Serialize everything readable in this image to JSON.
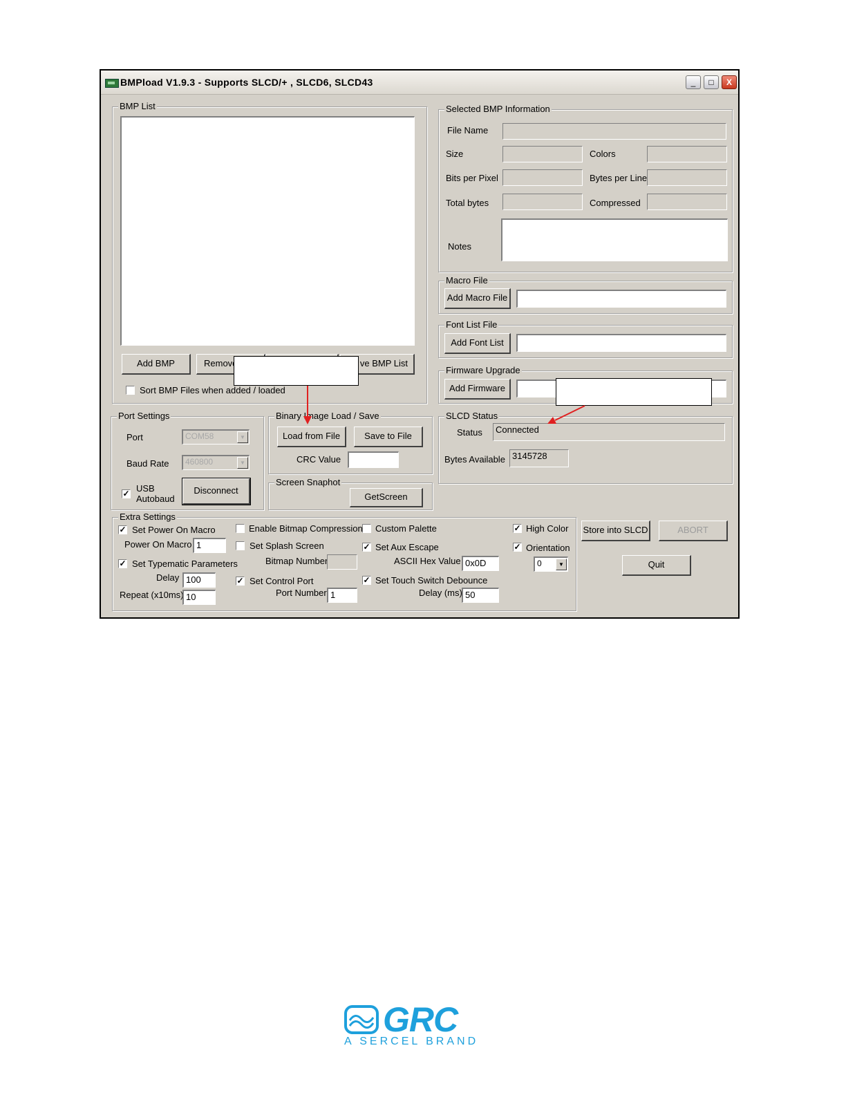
{
  "window": {
    "title": "BMPload V1.9.3 - Supports SLCD/+ , SLCD6, SLCD43",
    "controls": [
      "_",
      "□",
      "X"
    ]
  },
  "bmp_list": {
    "group_label": "BMP List",
    "buttons": {
      "add": "Add BMP",
      "remove": "Remove",
      "save": "ve BMP List"
    },
    "sort_checkbox": {
      "label": "Sort BMP Files when added / loaded",
      "checked": false
    }
  },
  "selected_bmp_info": {
    "group_label": "Selected BMP Information",
    "file_name_label": "File Name",
    "size_label": "Size",
    "colors_label": "Colors",
    "bits_per_pixel_label": "Bits per Pixel",
    "bytes_per_line_label": "Bytes per Line",
    "total_bytes_label": "Total bytes",
    "compressed_label": "Compressed",
    "notes_label": "Notes"
  },
  "macro_file": {
    "group_label": "Macro File",
    "button": "Add Macro File",
    "value": ""
  },
  "font_list_file": {
    "group_label": "Font List File",
    "button": "Add Font List",
    "value": ""
  },
  "firmware_upgrade": {
    "group_label": "Firmware Upgrade",
    "button": "Add Firmware",
    "value": ""
  },
  "port_settings": {
    "group_label": "Port Settings",
    "port_label": "Port",
    "port_value": "COM58",
    "baud_label": "Baud Rate",
    "baud_value": "460800",
    "usb_label_1": "USB",
    "usb_label_2": "Autobaud",
    "usb_checked": true,
    "disconnect_button": "Disconnect"
  },
  "binary_image": {
    "group_label": "Binary Image Load / Save",
    "load_button": "Load from File",
    "save_button": "Save to File",
    "crc_label": "CRC Value",
    "crc_value": ""
  },
  "screen_snapshot": {
    "group_label": "Screen Snaphot",
    "button": "GetScreen"
  },
  "slcd_status": {
    "group_label": "SLCD Status",
    "status_label": "Status",
    "status_value": "Connected",
    "bytes_label": "Bytes Available",
    "bytes_value": "3145728"
  },
  "extra_settings": {
    "group_label": "Extra Settings",
    "set_power_on_macro": {
      "label": "Set Power On Macro",
      "checked": true
    },
    "power_on_macro_label": "Power On Macro",
    "power_on_macro_value": "1",
    "set_typematic": {
      "label": "Set Typematic Parameters",
      "checked": true
    },
    "delay_label": "Delay",
    "delay_value": "100",
    "repeat_label": "Repeat (x10ms)",
    "repeat_value": "10",
    "enable_bitmap_compression": {
      "label": "Enable Bitmap Compression",
      "checked": false
    },
    "set_splash_screen": {
      "label": "Set Splash Screen",
      "checked": false
    },
    "bitmap_number_label": "Bitmap Number",
    "bitmap_number_value": "",
    "set_control_port": {
      "label": "Set Control Port",
      "checked": true
    },
    "port_number_label": "Port Number",
    "port_number_value": "1",
    "custom_palette": {
      "label": "Custom Palette",
      "checked": false
    },
    "set_aux_escape": {
      "label": "Set Aux Escape",
      "checked": true
    },
    "ascii_hex_label": "ASCII Hex Value",
    "ascii_hex_value": "0x0D",
    "set_touch_debounce": {
      "label": "Set Touch Switch Debounce",
      "checked": true
    },
    "debounce_delay_label": "Delay (ms)",
    "debounce_delay_value": "50",
    "high_color": {
      "label": "High Color",
      "checked": true
    },
    "orientation": {
      "label": "Orientation",
      "checked": true
    },
    "orientation_value": "0"
  },
  "actions": {
    "store_button": "Store into SLCD",
    "abort_button": "ABORT",
    "quit_button": "Quit"
  },
  "annotation": {
    "arrow_color": "#e02020"
  },
  "logo": {
    "name": "GRC",
    "tagline": "A SERCEL BRAND",
    "color": "#1ea0dc"
  }
}
